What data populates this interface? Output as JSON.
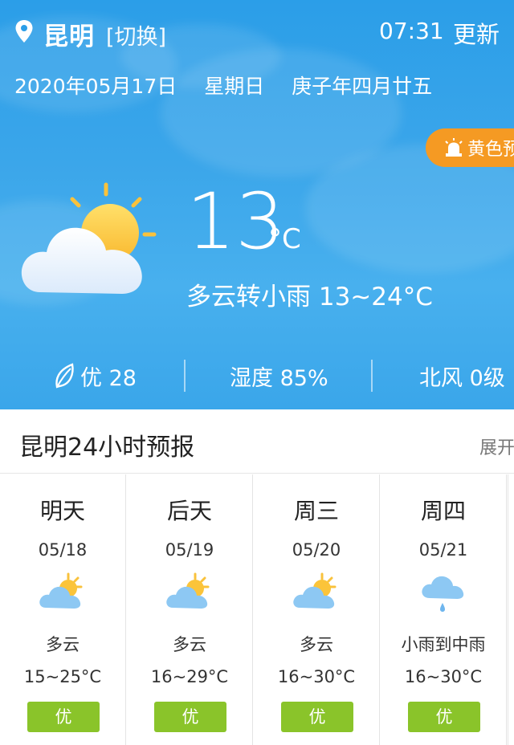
{
  "header": {
    "city": "昆明",
    "switch_label": "[切换]",
    "time": "07:31",
    "refresh_label": "更新"
  },
  "dateline": {
    "date": "2020年05月17日",
    "weekday": "星期日",
    "lunar": "庚子年四月廿五"
  },
  "alert": {
    "label": "黄色预"
  },
  "current": {
    "temperature": "13",
    "unit": "°C",
    "condition": "多云转小雨 13~24°C",
    "icon": "partly-cloudy-icon"
  },
  "stats": {
    "air_quality": "优 28",
    "humidity": "湿度 85%",
    "wind": "北风 0级"
  },
  "forecast_section": {
    "title": "昆明24小时预报",
    "expand_label": "展开"
  },
  "forecast": [
    {
      "name": "明天",
      "date": "05/18",
      "desc": "多云",
      "range": "15~25°C",
      "aqi": "优",
      "icon": "partly-cloudy-icon"
    },
    {
      "name": "后天",
      "date": "05/19",
      "desc": "多云",
      "range": "16~29°C",
      "aqi": "优",
      "icon": "partly-cloudy-icon"
    },
    {
      "name": "周三",
      "date": "05/20",
      "desc": "多云",
      "range": "16~30°C",
      "aqi": "优",
      "icon": "partly-cloudy-icon"
    },
    {
      "name": "周四",
      "date": "05/21",
      "desc": "小雨到中雨",
      "range": "16~30°C",
      "aqi": "优",
      "icon": "light-rain-icon"
    }
  ],
  "colors": {
    "sky": "#2b9ee8",
    "alert": "#f59a23",
    "aqi_good": "#8ac42a"
  }
}
